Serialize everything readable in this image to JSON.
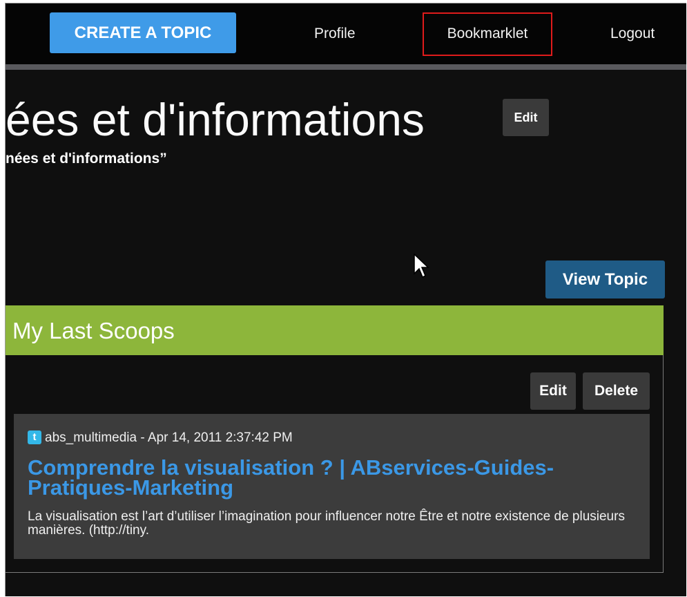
{
  "header": {
    "create_topic_label": "CREATE A TOPIC",
    "nav": {
      "profile": "Profile",
      "bookmarklet": "Bookmarklet",
      "logout": "Logout"
    }
  },
  "topic": {
    "title": "ées et d'informations",
    "edit_label": "Edit",
    "subtitle": "nées et d'informations”",
    "view_topic_label": "View Topic"
  },
  "scoops_panel": {
    "title": "My Last Scoops",
    "edit_label": "Edit",
    "delete_label": "Delete",
    "items": [
      {
        "source_icon": "twitter-icon",
        "source_line": "abs_multimedia - Apr 14, 2011 2:37:42 PM",
        "title": "Comprendre la visualisation ? | ABservices-Guides-Pratiques-Marketing",
        "excerpt": "La visualisation est l’art d’utiliser l’imagination pour influencer notre Être et notre existence de plusieurs manières. (http://tiny."
      }
    ]
  },
  "colors": {
    "background": "#0f0f0f",
    "create_button": "#3f9be8",
    "highlight_border": "#e01b1b",
    "view_topic_button": "#1f5b86",
    "panel_header": "#8db63b",
    "scoop_link": "#3b98e6"
  }
}
